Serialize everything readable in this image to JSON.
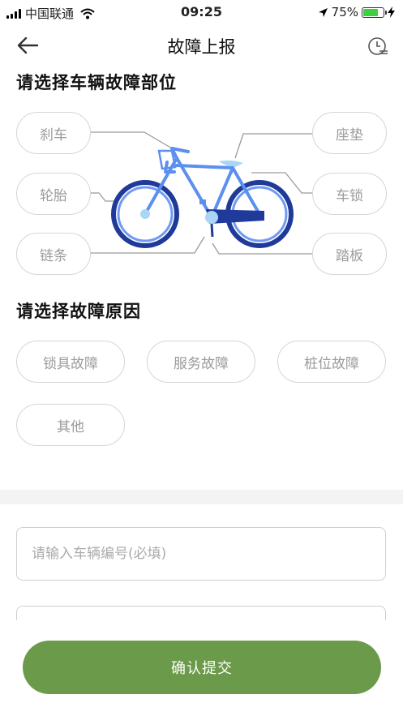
{
  "status_bar": {
    "carrier": "中国联通",
    "time": "09:25",
    "battery": "75%"
  },
  "nav": {
    "title": "故障上报"
  },
  "parts_section": {
    "title": "请选择车辆故障部位",
    "parts": [
      "刹车",
      "轮胎",
      "链条",
      "座垫",
      "车锁",
      "踏板"
    ]
  },
  "reasons_section": {
    "title": "请选择故障原因",
    "reasons": [
      "锁具故障",
      "服务故障",
      "桩位故障",
      "其他"
    ]
  },
  "form": {
    "bike_number_placeholder": "请输入车辆编号(必填)",
    "bike_number_value": "",
    "submit_label": "确认提交"
  },
  "colors": {
    "accent_green": "#6a9a4a",
    "bike_frame": "#5b8ff0",
    "bike_wheel": "#1f3a99",
    "battery_green": "#3ecf3e"
  }
}
